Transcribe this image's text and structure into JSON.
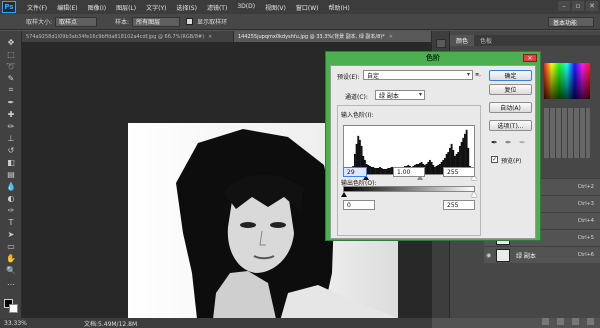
{
  "app": {
    "logo": "Ps"
  },
  "menu": [
    "文件(F)",
    "编辑(E)",
    "图像(I)",
    "图层(L)",
    "文字(Y)",
    "选择(S)",
    "滤镜(T)",
    "3D(D)",
    "视图(V)",
    "窗口(W)",
    "帮助(H)"
  ],
  "window_controls": [
    "–",
    "▫",
    "✕"
  ],
  "options_bar": {
    "sample_size_label": "取样大小:",
    "sample_size_value": "取样点",
    "sample_label": "样本:",
    "sample_value": "所有图层",
    "show_ring_label": "显示取样环",
    "workspace": "基本功能"
  },
  "tabs": [
    {
      "label": "574a9258d1l09b3ab34fe16c9bffda818102a4cdf.jpg @ 66.7%(RGB/8#)",
      "active": false
    },
    {
      "label": "144255jupqmx0kdyshfu.jpg @ 33.3%(背景 副本, 绿 副本/8)*",
      "active": true
    }
  ],
  "tools": [
    {
      "icon": "move-tool-icon",
      "glyph": "✥"
    },
    {
      "icon": "marquee-tool-icon",
      "glyph": "⬚"
    },
    {
      "icon": "lasso-tool-icon",
      "glyph": "➰"
    },
    {
      "icon": "quick-select-icon",
      "glyph": "✎"
    },
    {
      "icon": "crop-tool-icon",
      "glyph": "⌗"
    },
    {
      "icon": "eyedropper-tool-icon",
      "glyph": "✒"
    },
    {
      "icon": "healing-brush-icon",
      "glyph": "✚"
    },
    {
      "icon": "brush-tool-icon",
      "glyph": "✏"
    },
    {
      "icon": "clone-stamp-icon",
      "glyph": "⊥"
    },
    {
      "icon": "history-brush-icon",
      "glyph": "↺"
    },
    {
      "icon": "eraser-tool-icon",
      "glyph": "◧"
    },
    {
      "icon": "gradient-tool-icon",
      "glyph": "▤"
    },
    {
      "icon": "blur-tool-icon",
      "glyph": "💧"
    },
    {
      "icon": "dodge-tool-icon",
      "glyph": "◐"
    },
    {
      "icon": "pen-tool-icon",
      "glyph": "✑"
    },
    {
      "icon": "type-tool-icon",
      "glyph": "T"
    },
    {
      "icon": "path-select-icon",
      "glyph": "➤"
    },
    {
      "icon": "shape-tool-icon",
      "glyph": "▭"
    },
    {
      "icon": "hand-tool-icon",
      "glyph": "✋"
    },
    {
      "icon": "zoom-tool-icon",
      "glyph": "🔍"
    },
    {
      "icon": "more-tools-icon",
      "glyph": "…"
    }
  ],
  "status": {
    "zoom": "33.33%",
    "doc": "文档:5.49M/12.8M"
  },
  "right_panel": {
    "tabs": [
      "颜色",
      "色板"
    ],
    "channels": [
      {
        "name": "",
        "shortcut": "Ctrl+2",
        "selected": false
      },
      {
        "name": "",
        "shortcut": "Ctrl+3",
        "selected": false
      },
      {
        "name": "",
        "shortcut": "Ctrl+4",
        "selected": false
      },
      {
        "name": "",
        "shortcut": "Ctrl+5",
        "selected": false
      },
      {
        "name": "绿 副本",
        "shortcut": "Ctrl+6",
        "selected": false
      }
    ]
  },
  "levels": {
    "title": "色阶",
    "close": "✕",
    "preset_label": "预设(E):",
    "preset_value": "自定",
    "channel_label": "通道(C):",
    "channel_value": "绿 副本",
    "input_label": "输入色阶(I):",
    "input_black": "29",
    "input_gamma": "1.00",
    "input_white": "255",
    "output_label": "输出色阶(O):",
    "output_black": "0",
    "output_white": "255",
    "buttons": {
      "ok": "确定",
      "reset": "复位",
      "auto": "自动(A)",
      "options": "选项(T)..."
    },
    "preview_label": "预览(P)",
    "preview_checked": "✓",
    "histogram": [
      2,
      2,
      3,
      5,
      8,
      20,
      30,
      38,
      34,
      28,
      18,
      14,
      10,
      9,
      8,
      7,
      7,
      6,
      6,
      6,
      7,
      6,
      5,
      5,
      5,
      6,
      6,
      7,
      7,
      6,
      5,
      6,
      6,
      7,
      7,
      8,
      8,
      9,
      8,
      7,
      8,
      9,
      10,
      10,
      11,
      12,
      10,
      9,
      10,
      12,
      14,
      12,
      9,
      7,
      8,
      9,
      10,
      12,
      14,
      16,
      20,
      22,
      26,
      30,
      24,
      18,
      20,
      22,
      28,
      32,
      36,
      40,
      44,
      26,
      8,
      4
    ]
  }
}
